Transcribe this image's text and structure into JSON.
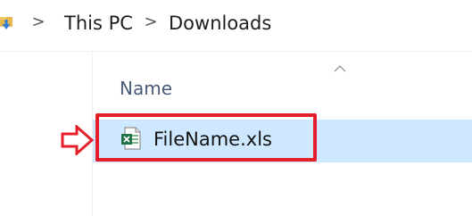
{
  "breadcrumb": {
    "items": [
      {
        "label": "This PC"
      },
      {
        "label": "Downloads"
      }
    ],
    "separator": ">",
    "folder_icon": "downloads-folder-icon"
  },
  "file_list": {
    "columns": [
      {
        "label": "Name",
        "sort": "ascending"
      }
    ],
    "rows": [
      {
        "name": "FileName.xls",
        "icon": "excel-file-icon",
        "selected": true
      }
    ]
  },
  "annotation": {
    "type": "arrow-and-box",
    "color": "#e51f2a"
  },
  "colors": {
    "selection": "#cde8ff",
    "header_text": "#4a5c78",
    "excel_green": "#217346"
  }
}
